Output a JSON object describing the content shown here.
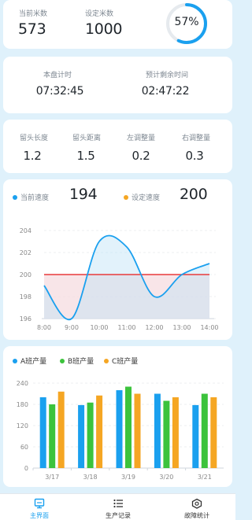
{
  "meters": {
    "current_label": "当前米数",
    "current_value": "573",
    "set_label": "设定米数",
    "set_value": "1000",
    "progress_text": "57%",
    "progress": 0.57
  },
  "timing": {
    "elapsed_label": "本盘计时",
    "elapsed_value": "07:32:45",
    "remaining_label": "预计剩余时间",
    "remaining_value": "02:47:22"
  },
  "params": [
    {
      "label": "留头长度",
      "value": "1.2"
    },
    {
      "label": "留头距离",
      "value": "1.5"
    },
    {
      "label": "左调整量",
      "value": "0.2"
    },
    {
      "label": "右调整量",
      "value": "0.3"
    }
  ],
  "speed": {
    "current_label": "当前速度",
    "current_value": "194",
    "set_label": "设定速度",
    "set_value": "200"
  },
  "colors": {
    "accent": "#1aa0ef",
    "orange": "#f5a623",
    "green": "#3cc33c",
    "red": "#e83a3a"
  },
  "chart_data": [
    {
      "type": "line",
      "x": [
        "8:00",
        "9:00",
        "10:00",
        "11:00",
        "12:00",
        "13:00",
        "14:00"
      ],
      "yticks": [
        "204",
        "202",
        "200",
        "198",
        "196"
      ],
      "ylim": [
        196,
        204
      ],
      "series": [
        {
          "values": [
            199,
            196,
            203,
            202.5,
            198,
            200,
            201
          ]
        }
      ],
      "reference_line": 200,
      "grid": true
    },
    {
      "type": "bar",
      "categories": [
        "3/17",
        "3/18",
        "3/19",
        "3/20",
        "3/21"
      ],
      "yticks": [
        "240",
        "180",
        "120",
        "60",
        "0"
      ],
      "ylim": [
        0,
        240
      ],
      "series": [
        {
          "name": "A班产量",
          "values": [
            200,
            178,
            220,
            210,
            178
          ]
        },
        {
          "name": "B班产量",
          "values": [
            180,
            185,
            230,
            190,
            210
          ]
        },
        {
          "name": "C班产量",
          "values": [
            216,
            205,
            210,
            200,
            200
          ]
        }
      ],
      "legend": "top-left",
      "grid": true
    }
  ],
  "tabbar": [
    {
      "label": "主界面",
      "icon": "monitor-icon",
      "active": true
    },
    {
      "label": "生产记录",
      "icon": "list-icon",
      "active": false
    },
    {
      "label": "故障统计",
      "icon": "fault-icon",
      "active": false
    }
  ]
}
